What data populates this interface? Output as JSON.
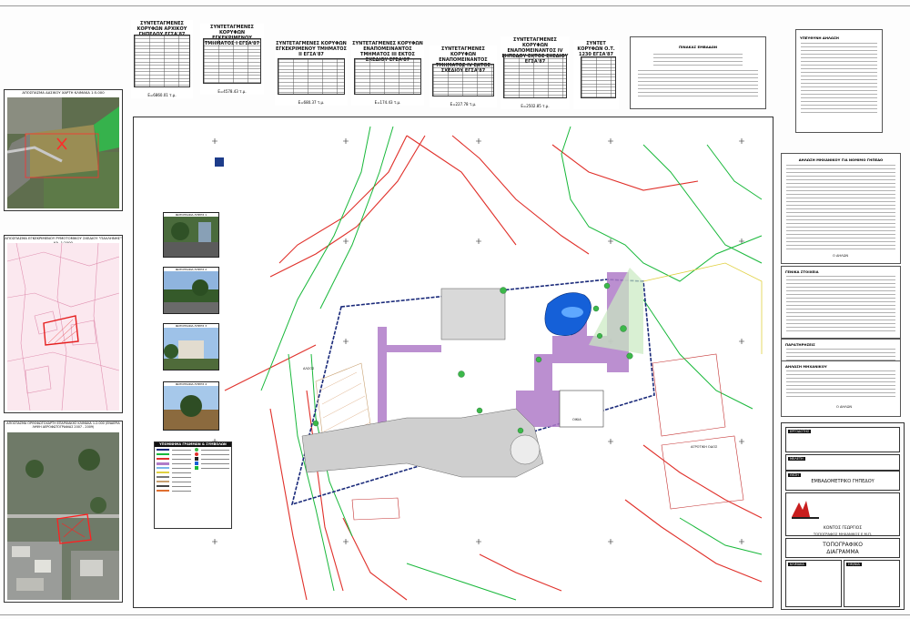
{
  "coordinate_tables": [
    {
      "title": "ΣΥΝΤΕΤΑΓΜΕΝΕΣ ΚΟΡΥΦΩΝ ΑΡΧΙΚΟΥ ΓΗΠΕΔΟΥ ΕΓΣΑ'87",
      "area": "Ε=6860.01 τ.μ."
    },
    {
      "title": "ΣΥΝΤΕΤΑΓΜΕΝΕΣ ΚΟΡΥΦΩΝ ΕΓΚΕΚΡΙΜΕΝΟΥ ΤΜΗΜΑΤΟΣ Ι ΕΓΣΑ'87",
      "area": "Ε=4578.43 τ.μ."
    },
    {
      "title": "ΣΥΝΤΕΤΑΓΜΕΝΕΣ ΚΟΡΥΦΩΝ ΕΓΚΕΚΡΙΜΕΝΟΥ ΤΜΗΜΑΤΟΣ ΙΙ ΕΓΣΑ'87",
      "area": "Ε=680.37 τ.μ."
    },
    {
      "title": "ΣΥΝΤΕΤΑΓΜΕΝΕΣ ΚΟΡΥΦΩΝ ΕΝΑΠΟΜΕΙΝΑΝΤΟΣ ΤΜΗΜΑΤΟΣ ΙΙΙ ΕΚΤΟΣ ΣΧΕΔΙΟΥ ΕΓΣΑ'87",
      "area": "Ε=174.43 τ.μ."
    },
    {
      "title": "ΣΥΝΤΕΤΑΓΜΕΝΕΣ ΚΟΡΥΦΩΝ ΕΝΑΠΟΜΕΙΝΑΝΤΟΣ ΤΜΗΜΑΤΟΣ IV ΕΚΤΟΣ ΣΧΕΔΙΟΥ ΕΓΣΑ'87",
      "area": "Ε=227.78 τ.μ."
    },
    {
      "title": "ΣΥΝΤΕΤΑΓΜΕΝΕΣ ΚΟΡΥΦΩΝ ΕΝΑΠΟΜΕΙΝΑΝΤΟΣ ΙV ΓΗΠΕΔΟΥ ΕΚΤΟΣ ΣΧΕΔΙΟΥ ΕΓΣΑ'87",
      "area": "Ε=2502.85 τ.μ."
    },
    {
      "title": "ΣΥΝΤΕΤ ΚΟΡΥΦΩΝ Ο.Τ. 1230 ΕΓΣΑ'87",
      "area": ""
    }
  ],
  "left_maps": [
    {
      "caption": "ΑΠΟΣΠΑΣΜΑ ΔΑΣΙΚΟΥ ΧΑΡΤΗ ΚΛΙΜΑΚΑ 1:5.000"
    },
    {
      "caption": "ΑΠΟΣΠΑΣΜΑ ΕΓΚΕΚΡΙΜΕΝΟΥ ΡΥΜΟΤΟΜΙΚΟΥ ΣΧΕΔΙΟΥ \"ΠΑΛΛΗΝΗΣ\" ΚΛ. 1:2000"
    },
    {
      "caption": "ΑΠΟΣΠΑΣΜΑ ΟΡΘΟΦΩΤΟΧΑΡΤΗ ΕΠΑΡΧΙΑΚΗΣ ΚΛΙΜΑΚΑ 1:2.000 (ΕΝΑΕΡΙΑ ΛΗΨΗ ΑΕΡΟΦΩΤΟΓΡΑΦΙΑΣ 2007 - 2009)"
    }
  ],
  "photos": [
    {
      "caption": "ΦΩΤΟΓΡΑΦΙΑ ΛΗΨΗΣ 1"
    },
    {
      "caption": "ΦΩΤΟΓΡΑΦΙΑ ΛΗΨΗΣ 2"
    },
    {
      "caption": "ΦΩΤΟΓΡΑΦΙΑ ΛΗΨΗΣ 3"
    },
    {
      "caption": "ΦΩΤΟΓΡΑΦΙΑ ΛΗΨΗΣ 4"
    }
  ],
  "legend": {
    "title": "ΥΠΟΜΝΗΜΑ ΓΡΑΜΜΩΝ & ΣΥΜΒΟΛΩΝ"
  },
  "notes_panels": {
    "top_center": {
      "title": "ΠΙΝΑΚΑΣ ΕΜΒΑΔΩΝ"
    },
    "top_right": {
      "title": "ΥΠΕΥΘΥΝΗ ΔΗΛΩΣΗ"
    },
    "right_1": {
      "title": "ΔΗΛΩΣΗ ΜΗΧΑΝΙΚΟΥ ΓΙΑ ΝΟΜΙΜΟ ΓΗΠΕΔΟ"
    },
    "right_2": {
      "title": "ΓΕΝΙΚΑ ΣΤΟΙΧΕΙΑ"
    },
    "right_3": {
      "title": "ΠΑΡΑΤΗΡΗΣΕΙΣ"
    },
    "right_4": {
      "title": "ΔΗΛΩΣΗ ΜΗΧΑΝΙΚΟΥ"
    },
    "signature": "Ο ΔΗΛΩΝ"
  },
  "title_block": {
    "project": "ΕΜΒΑΔΟΜΕΤΡΙΚΟ ΓΗΠΕΔΟΥ",
    "company_line1": "ΚΟΝΤΟΣ ΓΕΩΡΓΙΟΣ",
    "company_line2": "ΤΟΠΟΓΡΑΦΟΣ ΜΗΧΑΝΙΚΟΣ Ε.Μ.Π.",
    "drawing_title_1": "ΤΟΠΟΓΡΑΦΙΚΟ",
    "drawing_title_2": "ΔΙΑΓΡΑΜΜΑ",
    "tag_owner": "ΕΡΓΟΔΟΤΗΣ",
    "tag_study": "ΜΕΛΕΤΗ",
    "tag_location": "ΘΕΣΗ",
    "tag_scale": "ΚΛΙΜΑΚΑ",
    "tag_date": "ΗΜ/ΝΙΑ"
  },
  "plan_labels": {
    "left_road": "ΑΛΣΟΣ",
    "pool": "ΠΙΣΙΝΑ",
    "house": "ΟΙΚΙΑ",
    "right_road": "ΑΓΡΟΤΙΚΗ ΟΔΟΣ"
  },
  "colors": {
    "plot_boundary": "#1a2a7a",
    "green_lines": "#18b83a",
    "red_lines": "#e0302a",
    "paving": "#b07cc8",
    "pool": "#1560d8"
  }
}
